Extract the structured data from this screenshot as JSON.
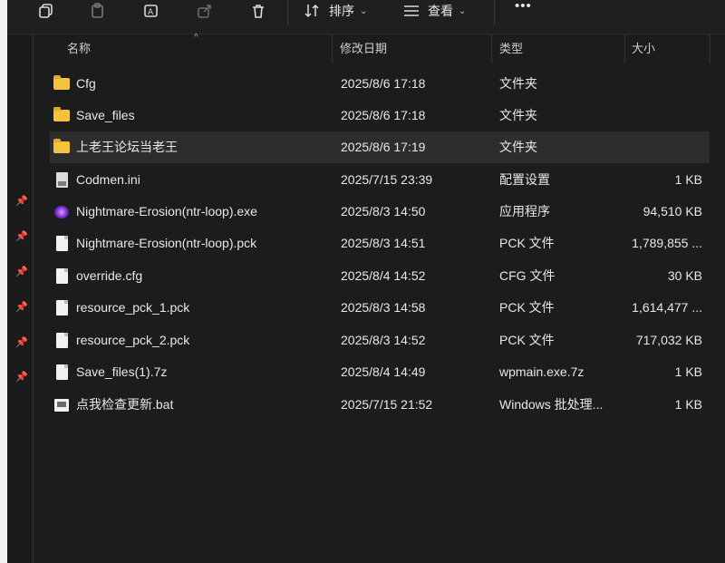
{
  "toolbar": {
    "icons": [
      "copy-icon",
      "paste-icon",
      "rename-icon",
      "share-icon",
      "delete-icon"
    ],
    "sort_label": "排序",
    "view_label": "查看",
    "more_label": "•••"
  },
  "columns": {
    "name": "名称",
    "date": "修改日期",
    "type": "类型",
    "size": "大小"
  },
  "files": [
    {
      "name": "Cfg",
      "date": "2025/8/6 17:18",
      "type": "文件夹",
      "size": "",
      "icon": "folder-icon"
    },
    {
      "name": "Save_files",
      "date": "2025/8/6 17:18",
      "type": "文件夹",
      "size": "",
      "icon": "folder-icon"
    },
    {
      "name": "上老王论坛当老王",
      "date": "2025/8/6 17:19",
      "type": "文件夹",
      "size": "",
      "icon": "folder-icon",
      "selected": true
    },
    {
      "name": "Codmen.ini",
      "date": "2025/7/15 23:39",
      "type": "配置设置",
      "size": "1 KB",
      "icon": "ini-file-icon"
    },
    {
      "name": "Nightmare-Erosion(ntr-loop).exe",
      "date": "2025/8/3 14:50",
      "type": "应用程序",
      "size": "94,510 KB",
      "icon": "exe-icon"
    },
    {
      "name": "Nightmare-Erosion(ntr-loop).pck",
      "date": "2025/8/3 14:51",
      "type": "PCK 文件",
      "size": "1,789,855 ...",
      "icon": "file-icon"
    },
    {
      "name": "override.cfg",
      "date": "2025/8/4 14:52",
      "type": "CFG 文件",
      "size": "30 KB",
      "icon": "file-icon"
    },
    {
      "name": "resource_pck_1.pck",
      "date": "2025/8/3 14:58",
      "type": "PCK 文件",
      "size": "1,614,477 ...",
      "icon": "file-icon"
    },
    {
      "name": "resource_pck_2.pck",
      "date": "2025/8/3 14:52",
      "type": "PCK 文件",
      "size": "717,032 KB",
      "icon": "file-icon"
    },
    {
      "name": "Save_files(1).7z",
      "date": "2025/8/4 14:49",
      "type": "wpmain.exe.7z",
      "size": "1 KB",
      "icon": "file-icon"
    },
    {
      "name": "点我检查更新.bat",
      "date": "2025/7/15 21:52",
      "type": "Windows 批处理...",
      "size": "1 KB",
      "icon": "bat-file-icon"
    }
  ],
  "nav_pins": 6
}
